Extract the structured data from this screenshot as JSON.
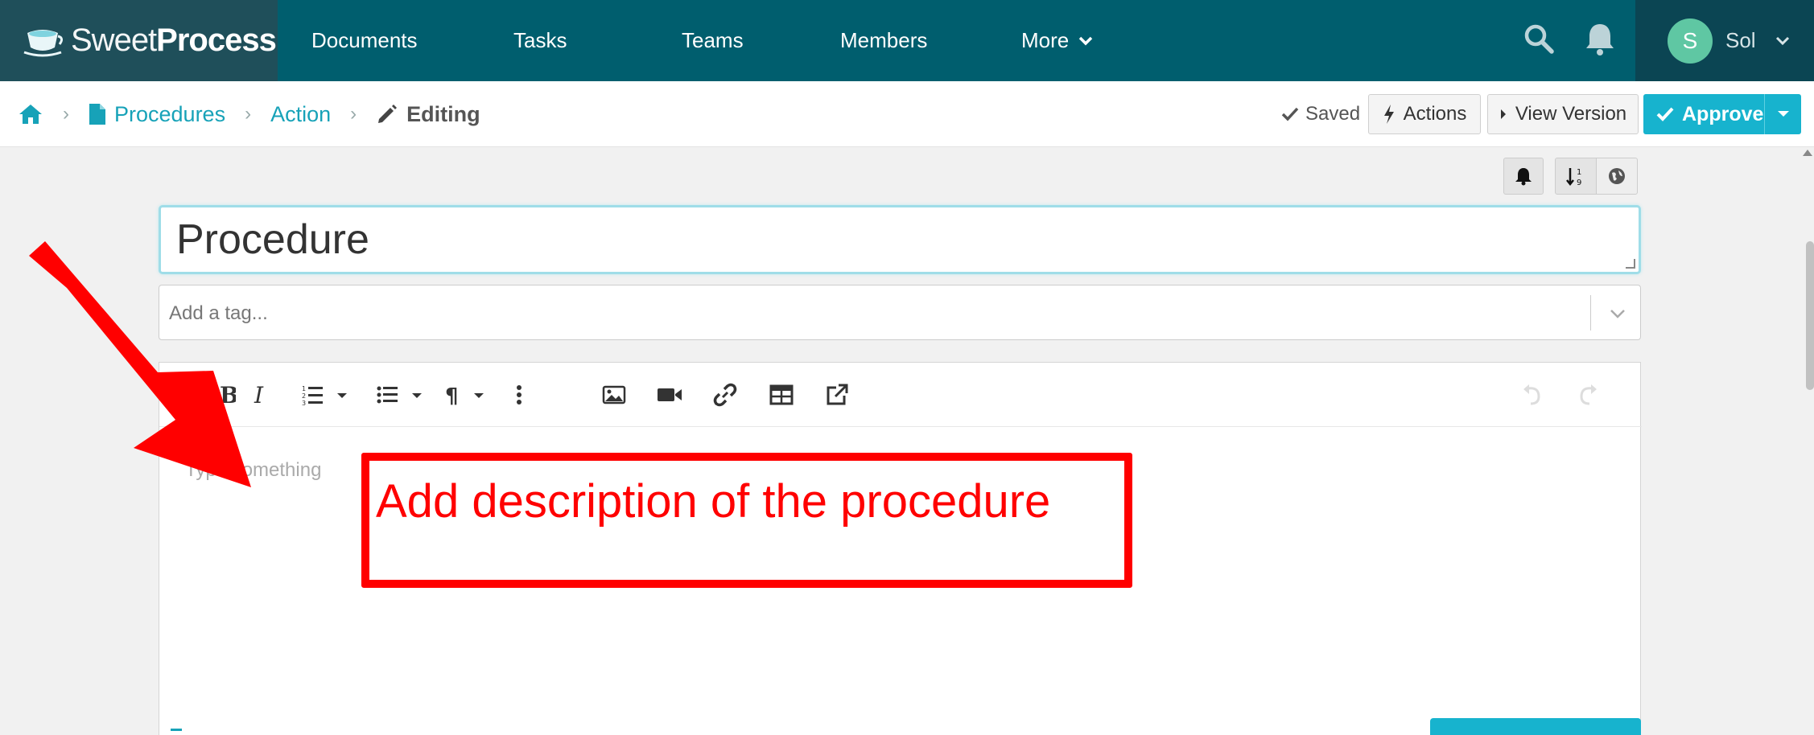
{
  "nav": {
    "logo_sweet": "Sweet",
    "logo_process": "Process",
    "items": [
      "Documents",
      "Tasks",
      "Teams",
      "Members",
      "More"
    ],
    "user_initial": "S",
    "user_name": "Sol"
  },
  "breadcrumb": {
    "procedures": "Procedures",
    "action": "Action",
    "editing": "Editing"
  },
  "actions": {
    "saved": "Saved",
    "actions": "Actions",
    "view_version": "View Version",
    "approve": "Approve"
  },
  "form": {
    "title": "Procedure",
    "tag_placeholder": "Add a tag...",
    "editor_placeholder": "Type something"
  },
  "annotation": {
    "text": "Add description of the procedure"
  },
  "colors": {
    "nav_bg": "#005e6e",
    "accent": "#17b3ce",
    "annotation": "#ff0000"
  }
}
